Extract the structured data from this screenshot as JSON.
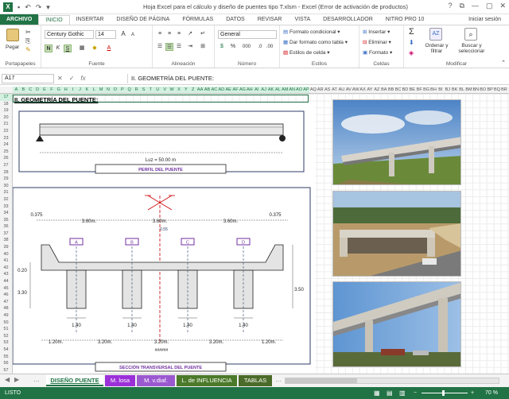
{
  "window": {
    "title": "Hoja Excel para el cálculo y diseño de puentes tipo T.xlsm - Excel (Error de activación de productos)",
    "controls": [
      "?",
      "⧉",
      "—",
      "▢",
      "✕"
    ]
  },
  "ribbon_tabs": {
    "file": "ARCHIVO",
    "items": [
      "INICIO",
      "INSERTAR",
      "DISEÑO DE PÁGINA",
      "FÓRMULAS",
      "DATOS",
      "REVISAR",
      "VISTA",
      "DESARROLLADOR",
      "NITRO PRO 10"
    ],
    "active": "INICIO",
    "signin": "Iniciar sesión"
  },
  "ribbon": {
    "clipboard": {
      "paste": "Pegar",
      "label": "Portapapeles"
    },
    "font": {
      "family": "Century Gothic",
      "size": "14",
      "bold": "N",
      "italic": "K",
      "underline": "S",
      "grow": "A",
      "shrink": "A",
      "label": "Fuente"
    },
    "alignment": {
      "label": "Alineación"
    },
    "number": {
      "format": "General",
      "percent": "%",
      "thousands": "000",
      "label": "Número"
    },
    "styles": {
      "conditional": "Formato condicional",
      "table": "Dar formato como tabla",
      "cell": "Estilos de celda",
      "label": "Estilos"
    },
    "cells": {
      "insert": "Insertar",
      "delete": "Eliminar",
      "format": "Formato",
      "label": "Celdas"
    },
    "editing": {
      "sort": "Ordenar y filtrar",
      "find": "Buscar y seleccionar",
      "label": "Modificar",
      "sigma": "Σ"
    }
  },
  "formula_bar": {
    "name_box": "A17",
    "fx": "fx",
    "content": "II. GEOMETRÍA DEL PUENTE:"
  },
  "columns": [
    "A",
    "B",
    "C",
    "D",
    "E",
    "F",
    "G",
    "H",
    "I",
    "J",
    "K",
    "L",
    "M",
    "N",
    "O",
    "P",
    "Q",
    "R",
    "S",
    "T",
    "U",
    "V",
    "W",
    "X",
    "Y",
    "Z",
    "AA",
    "AB",
    "AC",
    "AD",
    "AE",
    "AF",
    "AG",
    "AH",
    "AI",
    "AJ",
    "AK",
    "AL",
    "AM",
    "AN",
    "AO",
    "AP",
    "AQ",
    "AR",
    "AS",
    "AT",
    "AU",
    "AV",
    "AW",
    "AX",
    "AY",
    "AZ",
    "BA",
    "BB",
    "BC",
    "BD",
    "BE",
    "BF",
    "BG",
    "BH",
    "BI",
    "BJ",
    "BK",
    "BL",
    "BM",
    "BN",
    "BO",
    "BP",
    "BQ",
    "BR"
  ],
  "rows": [
    "17",
    "18",
    "19",
    "20",
    "21",
    "22",
    "23",
    "24",
    "25",
    "26",
    "27",
    "28",
    "29",
    "30",
    "31",
    "32",
    "33",
    "34",
    "35",
    "36",
    "37",
    "38",
    "39",
    "40",
    "41",
    "42",
    "43",
    "44",
    "45",
    "46",
    "47",
    "48",
    "49",
    "50",
    "51",
    "52",
    "53",
    "54",
    "55",
    "56",
    "57",
    "58",
    "59",
    "60",
    "61",
    "62"
  ],
  "sheet": {
    "section_title": "II. GEOMETRÍA DEL PUENTE:",
    "profile": {
      "span_label": "Luz = 50.00 m",
      "caption": "PERFIL DEL PUENTE"
    },
    "cross_section": {
      "cantilever_left": "0.375",
      "cantilever_right": "0.375",
      "girder_spacing": [
        "3.60m.",
        "3.60m.",
        "3.60m."
      ],
      "slab_thickness": "0.20",
      "girder_height_left": "3.30",
      "girder_height_right": "3.50",
      "crown_label": "0.55",
      "girder_labels": [
        "A",
        "B",
        "C",
        "D"
      ],
      "web_widths": [
        "1.40",
        "1.40",
        "1.40",
        "1.40"
      ],
      "bottom_spacing": [
        "1.20m.",
        "3.20m.",
        "3.20m.",
        "3.20m.",
        "1.20m."
      ],
      "caption": "SECCIÓN TRANSVERSAL DEL PUENTE",
      "footnote": "######"
    }
  },
  "sheet_tabs": [
    {
      "label": "DISEÑO PUENTE",
      "color": "#ffffff",
      "text": "#217346",
      "active": true
    },
    {
      "label": "M. losa",
      "color": "#9b30d9",
      "text": "#ffffff",
      "active": false
    },
    {
      "label": "M. v.diaf.",
      "color": "#9b59d0",
      "text": "#ffffff",
      "active": false
    },
    {
      "label": "L. de INFLUENCIA",
      "color": "#4b7a2a",
      "text": "#ffffff",
      "active": false
    },
    {
      "label": "TABLAS",
      "color": "#4b6b2a",
      "text": "#ffffff",
      "active": false
    }
  ],
  "status": {
    "ready": "LISTO",
    "zoom": "70 %",
    "minus": "−",
    "plus": "+"
  },
  "colors": {
    "excel_green": "#217346",
    "purple": "#7030a0",
    "red_axis": "#cc0000"
  }
}
